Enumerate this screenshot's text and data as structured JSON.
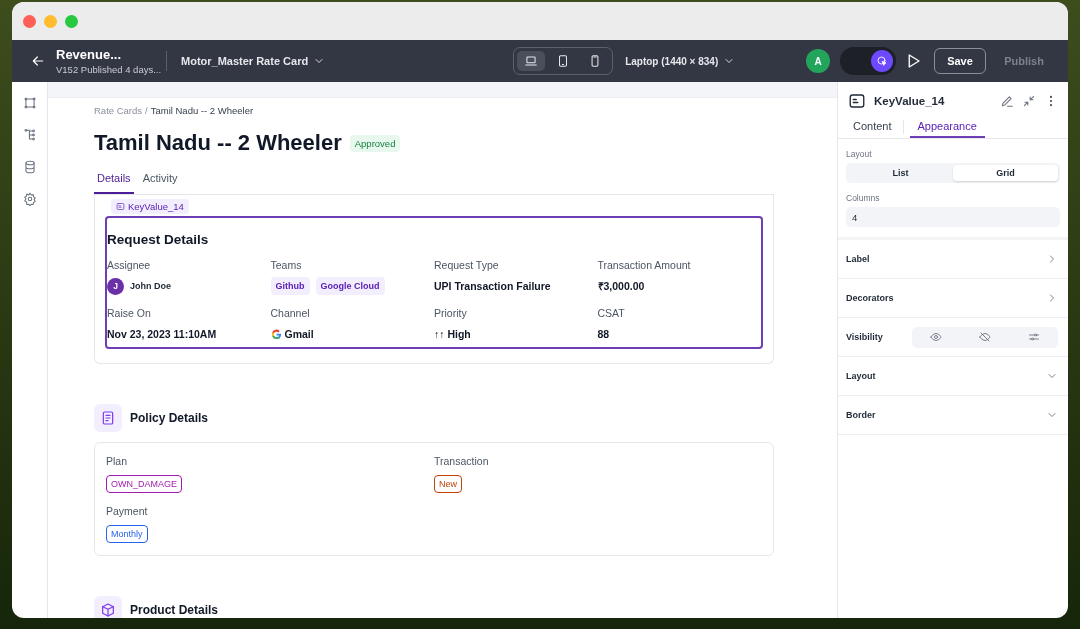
{
  "toolbar": {
    "title": "Revenue...",
    "subtitle": "V152 Published 4 days...",
    "page_select": "Motor_Master Rate Card",
    "devices": [
      {
        "kind": "laptop",
        "selected": true
      },
      {
        "kind": "tablet",
        "selected": false
      },
      {
        "kind": "phone",
        "selected": false
      }
    ],
    "viewport": "Laptop (1440 × 834)",
    "avatar": "A",
    "mode_on": true,
    "save": "Save",
    "publish": "Publish",
    "publish_disabled": true
  },
  "page": {
    "breadcrumb": {
      "items": [
        "Rate Cards",
        "Tamil Nadu -- 2 Wheeler"
      ],
      "separator": "/"
    },
    "title": "Tamil Nadu -- 2 Wheeler",
    "status": "Approved",
    "tabs": [
      {
        "label": "Details",
        "selected": true
      },
      {
        "label": "Activity",
        "selected": false
      }
    ],
    "selected_tag": "KeyValue_14",
    "request": {
      "title": "Request Details",
      "fields": [
        {
          "label": "Assignee",
          "kind": "person",
          "avatar": "J",
          "value": "John Doe"
        },
        {
          "label": "Teams",
          "kind": "tags",
          "tags": [
            "Github",
            "Google Cloud"
          ]
        },
        {
          "label": "Request Type",
          "kind": "text",
          "value": "UPI Transaction Failure"
        },
        {
          "label": "Transaction Amount",
          "kind": "text",
          "value": "₹3,000.00"
        },
        {
          "label": "Raise On",
          "kind": "text",
          "value": "Nov 23, 2023 11:10AM"
        },
        {
          "label": "Channel",
          "kind": "gmail",
          "value": "Gmail"
        },
        {
          "label": "Priority",
          "kind": "text",
          "value": "↑↑ High"
        },
        {
          "label": "CSAT",
          "kind": "text",
          "value": "88"
        }
      ]
    },
    "policy": {
      "title": "Policy Details",
      "fields": [
        {
          "label": "Plan",
          "value": "OWN_DAMAGE",
          "color": "#a21caf"
        },
        {
          "label": "Transaction",
          "value": "New",
          "color": "#c2410c"
        },
        {
          "label": "Payment",
          "value": "Monthly",
          "color": "#2563eb"
        }
      ]
    },
    "product": {
      "title": "Product Details"
    }
  },
  "panel": {
    "component": "KeyValue_14",
    "tabs": [
      {
        "label": "Content",
        "selected": false
      },
      {
        "label": "Appearance",
        "selected": true
      }
    ],
    "layout_label": "Layout",
    "layout_options": [
      {
        "label": "List",
        "selected": false
      },
      {
        "label": "Grid",
        "selected": true
      }
    ],
    "columns_label": "Columns",
    "columns_value": "4",
    "sections": [
      {
        "label": "Label",
        "kind": "link"
      },
      {
        "label": "Decorators",
        "kind": "link"
      },
      {
        "label": "Visibility",
        "kind": "visibility"
      },
      {
        "label": "Layout",
        "kind": "collapse"
      },
      {
        "label": "Border",
        "kind": "collapse"
      }
    ]
  }
}
